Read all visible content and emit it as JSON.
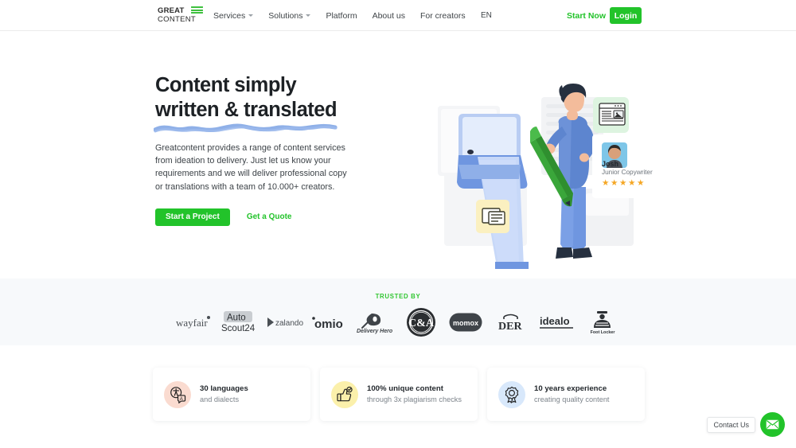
{
  "header": {
    "logo": {
      "line1": "GREAT",
      "line2": "CONTENT",
      "icon": "logo-bars-icon"
    },
    "nav": [
      {
        "label": "Services",
        "caret": true
      },
      {
        "label": "Solutions",
        "caret": true
      },
      {
        "label": "Platform",
        "caret": false
      },
      {
        "label": "About us",
        "caret": false
      },
      {
        "label": "For creators",
        "caret": false
      }
    ],
    "language": "EN",
    "start_now": "Start Now",
    "login": "Login",
    "accent_green": "#22c32a"
  },
  "hero": {
    "headline_line1": "Content simply",
    "headline_line2": "written & translated",
    "underline_color": "#8fb0e8",
    "paragraph": "Greatcontent provides a range of content services from ideation to delivery. Just let us know your requirements and we will deliver professional copy or translations with a team of 10.000+ creators.",
    "primary_cta": "Start a Project",
    "secondary_cta": "Get a Quote",
    "illustration": {
      "person_name": "Josh",
      "person_role": "Junior Copywriter",
      "rating_stars": 5,
      "star_color": "#f5a623",
      "badge_green_bg": "#ddf4e0",
      "badge_yellow_bg": "#fbf0c0",
      "pencil_color": "#33a132",
      "shirt_color": "#5d85cf"
    }
  },
  "trusted": {
    "label": "TRUSTED BY",
    "label_color": "#2fc62f",
    "background": "#f7f9fb",
    "brands": [
      {
        "name": "wayfair",
        "id": "brand-wayfair"
      },
      {
        "name": "AutoScout24",
        "id": "brand-autoscout24",
        "line1": "Auto",
        "line2": "Scout24"
      },
      {
        "name": "zalando",
        "id": "brand-zalando"
      },
      {
        "name": "omio",
        "id": "brand-omio"
      },
      {
        "name": "Delivery Hero",
        "id": "brand-delivery-hero"
      },
      {
        "name": "C&A",
        "id": "brand-ca"
      },
      {
        "name": "momox",
        "id": "brand-momox"
      },
      {
        "name": "DER",
        "id": "brand-der"
      },
      {
        "name": "idealo",
        "id": "brand-idealo"
      },
      {
        "name": "Foot Locker",
        "id": "brand-foot-locker"
      }
    ]
  },
  "features": [
    {
      "title": "30 languages",
      "subtitle": "and dialects",
      "icon": "translate-icon",
      "bg": "#fadbd0"
    },
    {
      "title": "100% unique content",
      "subtitle": "through 3x plagiarism checks",
      "icon": "thumbs-up-icon",
      "bg": "#fbf0ab"
    },
    {
      "title": "10 years experience",
      "subtitle": "creating quality content",
      "icon": "award-badge-icon",
      "bg": "#d8e8fb"
    }
  ],
  "contact": {
    "tooltip": "Contact Us",
    "icon": "envelope-icon",
    "button_color": "#22c32a"
  }
}
